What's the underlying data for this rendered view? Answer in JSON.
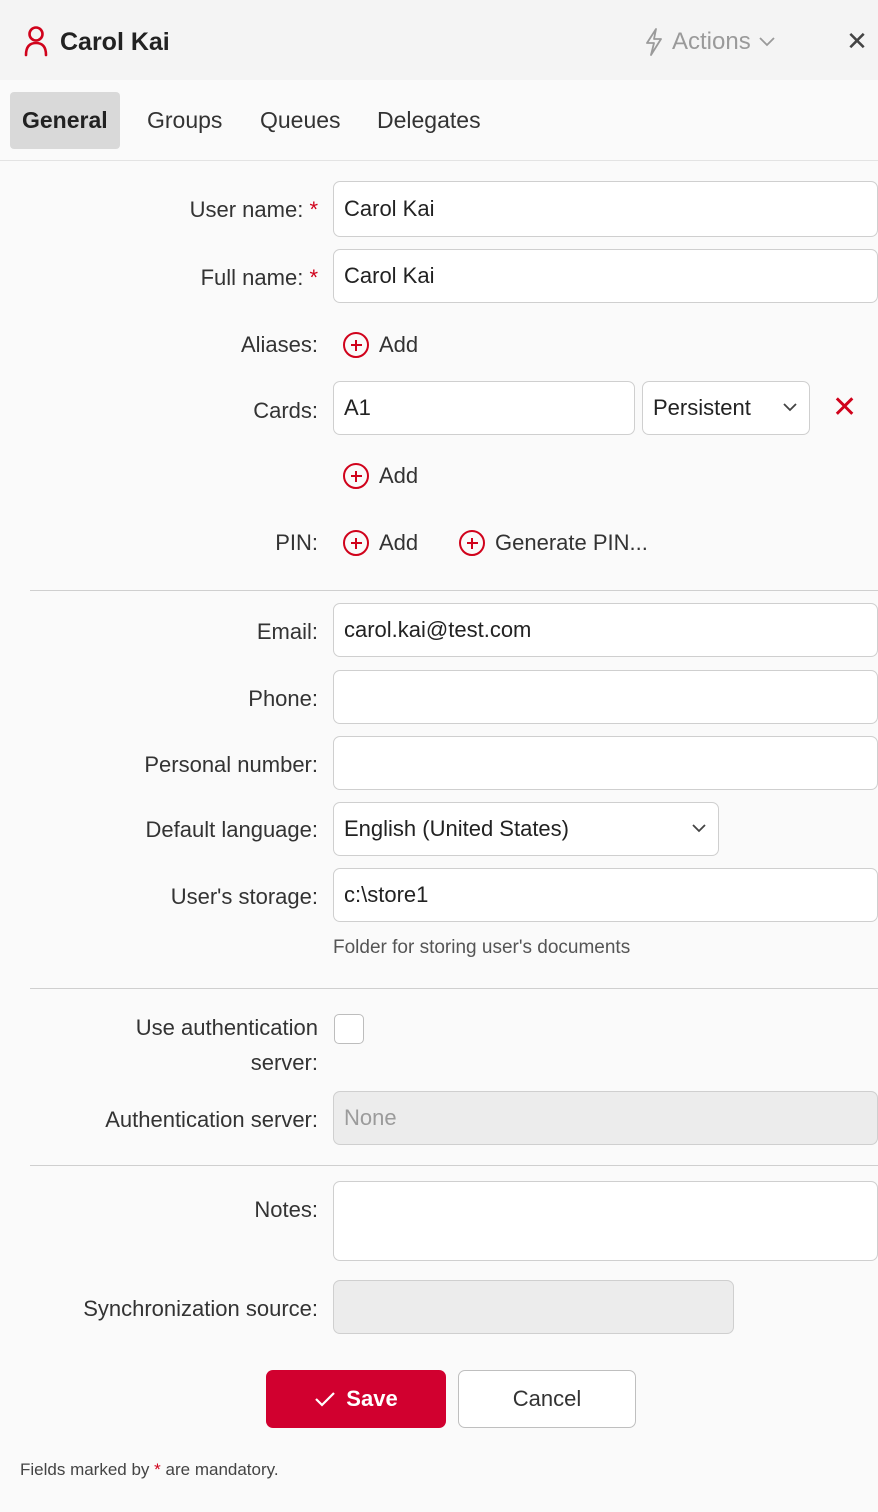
{
  "header": {
    "title": "Carol Kai",
    "actions_label": "Actions",
    "icons": [
      "user-icon",
      "lightning-icon",
      "chevron-down-icon",
      "close-icon"
    ]
  },
  "tabs": [
    {
      "label": "General",
      "active": true
    },
    {
      "label": "Groups",
      "active": false
    },
    {
      "label": "Queues",
      "active": false
    },
    {
      "label": "Delegates",
      "active": false
    }
  ],
  "form": {
    "user_name": {
      "label": "User name:",
      "value": "Carol Kai",
      "required_mark": "*"
    },
    "full_name": {
      "label": "Full name:",
      "value": "Carol Kai",
      "required_mark": "*"
    },
    "aliases": {
      "label": "Aliases:",
      "add_label": "Add"
    },
    "cards": {
      "label": "Cards:",
      "value": "A1",
      "type_selected": "Persistent",
      "remove_glyph": "✕",
      "add_label": "Add"
    },
    "pin": {
      "label": "PIN:",
      "add_label": "Add",
      "generate_label": "Generate PIN..."
    },
    "email": {
      "label": "Email:",
      "value": "carol.kai@test.com"
    },
    "phone": {
      "label": "Phone:",
      "value": ""
    },
    "personal_number": {
      "label": "Personal number:",
      "value": ""
    },
    "default_language": {
      "label": "Default language:",
      "selected": "English (United States)"
    },
    "users_storage": {
      "label": "User's storage:",
      "value": "c:\\store1",
      "hint": "Folder for storing user's documents"
    },
    "use_auth_server": {
      "label_line1": "Use authentication",
      "label_line2": "server:",
      "checked": false
    },
    "auth_server": {
      "label": "Authentication server:",
      "value": "None"
    },
    "notes": {
      "label": "Notes:",
      "value": ""
    },
    "sync_source": {
      "label": "Synchronization source:",
      "value": ""
    }
  },
  "footer": {
    "save_label": "Save",
    "cancel_label": "Cancel",
    "note_prefix": "Fields marked by",
    "note_star": "*",
    "note_suffix": "are mandatory."
  },
  "colors": {
    "accent": "#d0021b",
    "save_bg": "#d1002f"
  }
}
